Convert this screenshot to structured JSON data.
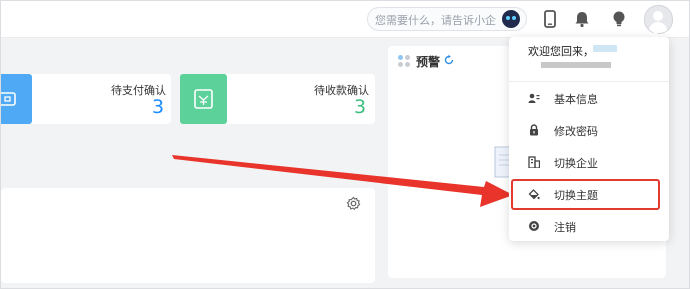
{
  "header": {
    "search_placeholder": "您需要什么，请告诉小企",
    "icons": [
      "bot-icon",
      "mobile-icon",
      "bell-icon",
      "bulb-icon",
      "avatar-icon"
    ]
  },
  "stats": [
    {
      "label": "待支付确认",
      "value": "3",
      "color": "#1a8cff"
    },
    {
      "label": "待收款确认",
      "value": "3",
      "color": "#3cbf7f"
    }
  ],
  "warning_panel": {
    "title": "预警"
  },
  "user_menu": {
    "welcome": "欢迎您回来，",
    "items": [
      {
        "label": "基本信息",
        "icon": "user-card-icon"
      },
      {
        "label": "修改密码",
        "icon": "lock-icon"
      },
      {
        "label": "切换企业",
        "icon": "building-icon"
      },
      {
        "label": "切换主题",
        "icon": "paint-bucket-icon"
      },
      {
        "label": "注销",
        "icon": "logout-icon"
      }
    ]
  },
  "colors": {
    "accent": "#1a8cff",
    "highlight": "#e23a2e",
    "arrow": "#e8342a"
  }
}
